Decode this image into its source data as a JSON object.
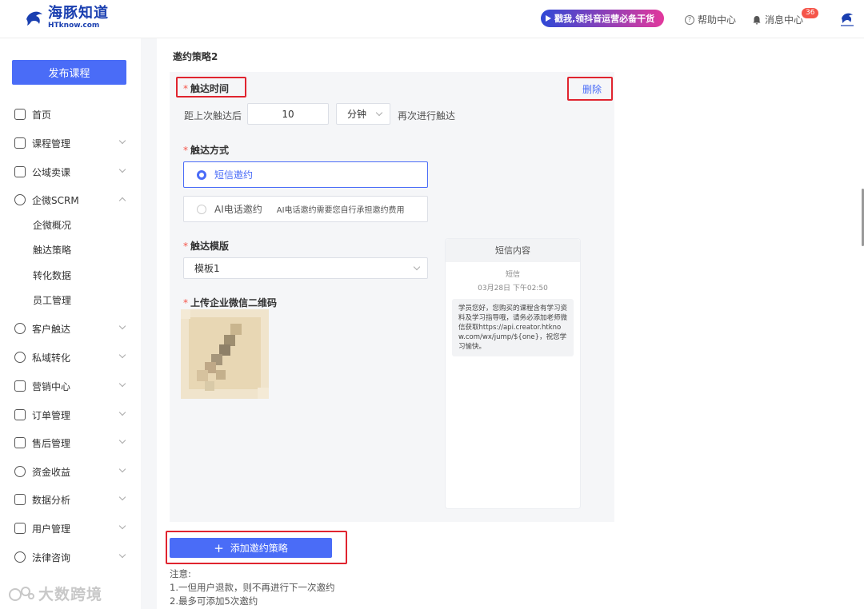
{
  "header": {
    "logo_cn": "海豚知道",
    "logo_en": "HTknow.com",
    "promo": "戳我,领抖音运营必备干货",
    "help": "帮助中心",
    "messages": "消息中心",
    "message_count": "36"
  },
  "sidebar": {
    "publish": "发布课程",
    "items": [
      {
        "label": "首页",
        "icon": "home-icon"
      },
      {
        "label": "课程管理",
        "icon": "course-icon"
      },
      {
        "label": "公域卖课",
        "icon": "public-sale-icon"
      },
      {
        "label": "企微SCRM",
        "icon": "scrm-icon",
        "expanded": true
      },
      {
        "label": "客户触达",
        "icon": "reach-icon"
      },
      {
        "label": "私域转化",
        "icon": "private-icon"
      },
      {
        "label": "营销中心",
        "icon": "marketing-icon"
      },
      {
        "label": "订单管理",
        "icon": "order-icon"
      },
      {
        "label": "售后管理",
        "icon": "aftersale-icon"
      },
      {
        "label": "资金收益",
        "icon": "funds-icon"
      },
      {
        "label": "数据分析",
        "icon": "data-icon"
      },
      {
        "label": "用户管理",
        "icon": "user-icon"
      },
      {
        "label": "法律咨询",
        "icon": "legal-icon"
      }
    ],
    "sub_items": [
      "企微概况",
      "触达策略",
      "转化数据",
      "员工管理"
    ]
  },
  "main": {
    "section_title": "邀约策略2",
    "reach_time": {
      "label": "触达时间",
      "delete": "删除",
      "prefix": "距上次触达后",
      "value": "10",
      "unit": "分钟",
      "suffix": "再次进行触达"
    },
    "reach_method": {
      "label": "触达方式",
      "options": [
        {
          "label": "短信邀约",
          "selected": true,
          "note": ""
        },
        {
          "label": "AI电话邀约",
          "selected": false,
          "note": "AI电话邀约需要您自行承担邀约费用"
        }
      ]
    },
    "template": {
      "label": "触达模版",
      "value": "模板1"
    },
    "qr_upload": {
      "label": "上传企业微信二维码"
    },
    "sms_preview": {
      "title": "短信内容",
      "sender": "短信",
      "time": "03月28日 下午02:50",
      "body": "学员您好，您购买的课程含有学习资料及学习指导哦，请务必添加老师微信获取https://api.creator.htknow.com/wx/jump/${one}，祝您学习愉快。"
    },
    "add_button": "添加邀约策略",
    "notes": [
      "注意:",
      "1.一但用户退款，则不再进行下一次邀约",
      "2.最多可添加5次邀约"
    ]
  },
  "watermark": "大数跨境",
  "colors": {
    "primary": "#4a6cf7",
    "highlight_border": "#e0242f",
    "required": "#f5554a"
  }
}
